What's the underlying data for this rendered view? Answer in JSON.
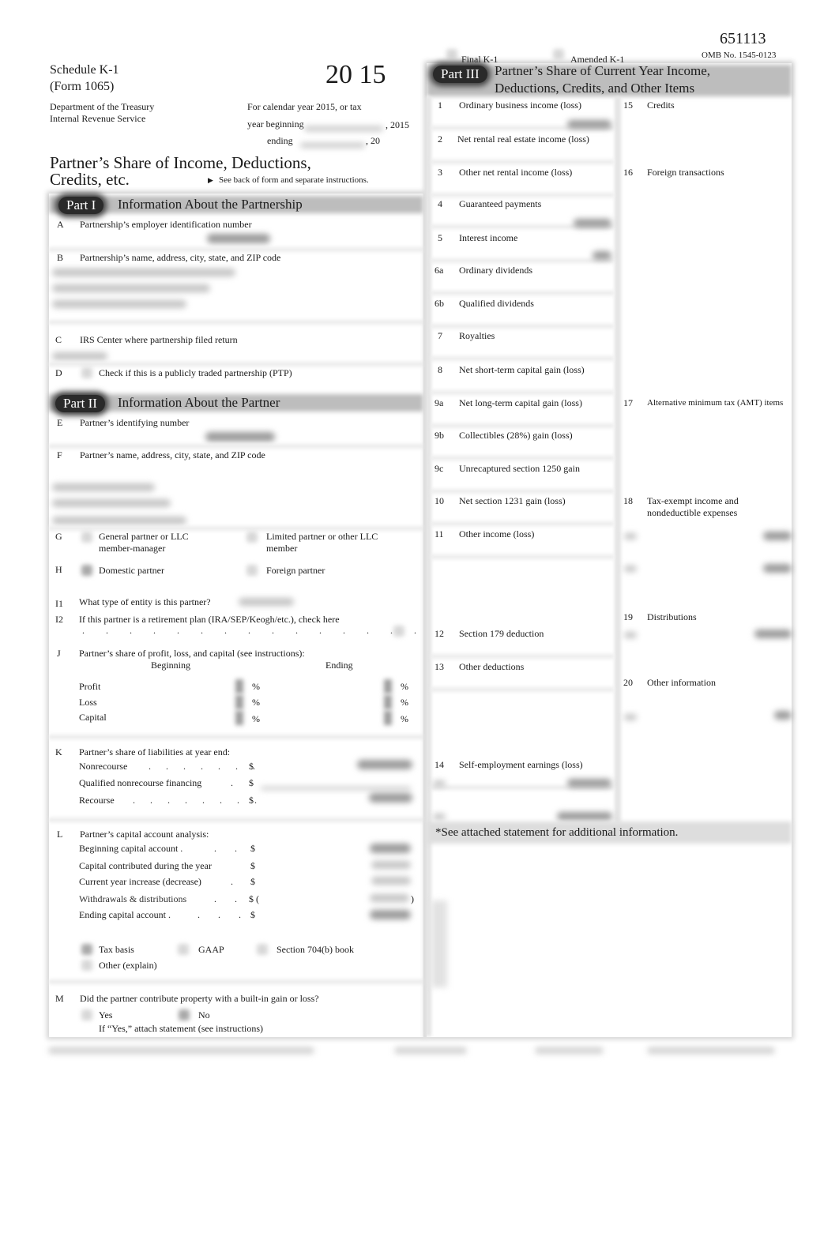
{
  "header": {
    "form_number": "651113",
    "omb": "OMB No. 1545-0123",
    "schedule": "Schedule K-1",
    "form": "(Form 1065)",
    "year": "20 15",
    "agency_line1": "Department of the Treasury",
    "agency_line2": "Internal Revenue Service",
    "calendar_line": "For calendar year 2015, or tax",
    "year_beginning_label": "year beginning",
    "year_beginning_suffix": ", 2015",
    "ending_label": "ending",
    "ending_suffix": ", 20",
    "title_line1": "Partner’s Share of Income, Deductions,",
    "title_line2": "Credits, etc.",
    "see_back": "See back of form and separate instructions.",
    "final_k1": "Final K-1",
    "amended_k1": "Amended K-1"
  },
  "part1": {
    "tag": "Part I",
    "title": "Information About the Partnership",
    "items": [
      {
        "key": "A",
        "label": "Partnership’s employer identification number"
      },
      {
        "key": "B",
        "label": "Partnership’s name, address, city, state, and ZIP code"
      },
      {
        "key": "C",
        "label": "IRS Center where partnership filed return"
      },
      {
        "key": "D",
        "label": "Check if this is a publicly traded partnership (PTP)"
      }
    ]
  },
  "part2": {
    "tag": "Part II",
    "title": "Information About the Partner",
    "E": {
      "key": "E",
      "label": "Partner’s identifying number"
    },
    "F": {
      "key": "F",
      "label": "Partner’s name, address, city, state, and ZIP code"
    },
    "G": {
      "key": "G",
      "opt1": "General partner or LLC",
      "opt1b": "member-manager",
      "opt2": "Limited partner or other LLC",
      "opt2b": "member"
    },
    "H": {
      "key": "H",
      "opt1": "Domestic partner",
      "opt2": "Foreign partner"
    },
    "I1": {
      "key": "I1",
      "label": "What type of entity is this partner?"
    },
    "I2": {
      "key": "I2",
      "label": "If this partner is a retirement plan (IRA/SEP/Keogh/etc.), check here"
    },
    "J": {
      "key": "J",
      "label": "Partner’s share of profit, loss, and capital (see instructions):",
      "beginning": "Beginning",
      "ending": "Ending",
      "rows": [
        "Profit",
        "Loss",
        "Capital"
      ],
      "pct": "%"
    },
    "K": {
      "key": "K",
      "label": "Partner’s share of liabilities at year end:",
      "rows": [
        {
          "label": "Nonrecourse",
          "dots": ". . . . . . .",
          "cur": "$"
        },
        {
          "label": "Qualified nonrecourse financing",
          "dots": ".",
          "cur": "$"
        },
        {
          "label": "Recourse",
          "dots": ". . . . . . . .",
          "cur": "$"
        }
      ]
    },
    "L": {
      "key": "L",
      "label": "Partner’s capital account analysis:",
      "rows": [
        {
          "label": "Beginning  capital  account .",
          "dots": ". .",
          "cur": "$"
        },
        {
          "label": "Capital contributed during the year",
          "dots": "",
          "cur": "$"
        },
        {
          "label": "Current year increase (decrease)",
          "dots": ".",
          "cur": "$"
        },
        {
          "label": "Withdrawals & distributions",
          "dots": ". .",
          "cur": "$  (",
          "close": ")"
        },
        {
          "label": "Ending capital account .",
          "dots": ". . .",
          "cur": "$"
        }
      ],
      "basis": [
        "Tax basis",
        "GAAP",
        "Section 704(b) book",
        "Other (explain)"
      ]
    },
    "M": {
      "key": "M",
      "label": "Did the partner contribute property with a built-in gain or loss?",
      "yes": "Yes",
      "no": "No",
      "note": "If “Yes,” attach statement (see instructions)"
    }
  },
  "part3": {
    "tag": "Part III",
    "title_line1": "Partner’s Share of Current Year Income,",
    "title_line2": "Deductions, Credits, and Other Items",
    "left": [
      {
        "n": "1",
        "label": "Ordinary business income (loss)"
      },
      {
        "n": "2",
        "label": "Net rental real estate income (loss)"
      },
      {
        "n": "3",
        "label": "Other net rental income (loss)"
      },
      {
        "n": "4",
        "label": "Guaranteed payments"
      },
      {
        "n": "5",
        "label": "Interest income"
      },
      {
        "n": "6a",
        "label": "Ordinary dividends"
      },
      {
        "n": "6b",
        "label": "Qualified dividends"
      },
      {
        "n": "7",
        "label": "Royalties"
      },
      {
        "n": "8",
        "label": "Net short-term capital gain (loss)"
      },
      {
        "n": "9a",
        "label": "Net long-term capital gain (loss)"
      },
      {
        "n": "9b",
        "label": "Collectibles (28%) gain (loss)"
      },
      {
        "n": "9c",
        "label": "Unrecaptured section 1250 gain"
      },
      {
        "n": "10",
        "label": "Net section 1231 gain (loss)"
      },
      {
        "n": "11",
        "label": "Other income (loss)"
      },
      {
        "n": "12",
        "label": "Section 179 deduction"
      },
      {
        "n": "13",
        "label": "Other deductions"
      },
      {
        "n": "14",
        "label": "Self-employment earnings (loss)"
      }
    ],
    "right": [
      {
        "n": "15",
        "label": "Credits"
      },
      {
        "n": "16",
        "label": "Foreign transactions"
      },
      {
        "n": "17",
        "label": "Alternative minimum tax (AMT) items"
      },
      {
        "n": "18",
        "label": "Tax-exempt income and",
        "label2": "nondeductible expenses"
      },
      {
        "n": "19",
        "label": "Distributions"
      },
      {
        "n": "20",
        "label": "Other information"
      }
    ],
    "statement_note": "*See attached statement for additional information."
  }
}
